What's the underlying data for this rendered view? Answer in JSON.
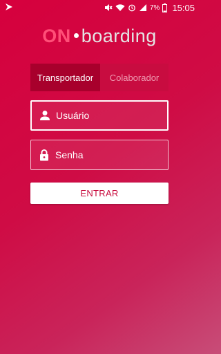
{
  "status_bar": {
    "battery_percent": "7%",
    "time": "15:05",
    "icons": [
      "app-notification-icon",
      "mute-icon",
      "wifi-icon",
      "alarm-icon",
      "signal-icon",
      "battery-icon"
    ]
  },
  "logo": {
    "prefix": "ON",
    "suffix": "boarding",
    "prefix_color": "#ff4f78"
  },
  "tabs": [
    {
      "label": "Transportador",
      "active": true
    },
    {
      "label": "Colaborador",
      "active": false
    }
  ],
  "form": {
    "username_placeholder": "Usuário",
    "username_value": "",
    "password_placeholder": "Senha",
    "password_value": "",
    "submit_label": "ENTRAR"
  },
  "colors": {
    "background": "#d6003d",
    "active_tab": "#a8002c",
    "inactive_tab": "#c80c40",
    "button_text": "#c80c3e"
  }
}
